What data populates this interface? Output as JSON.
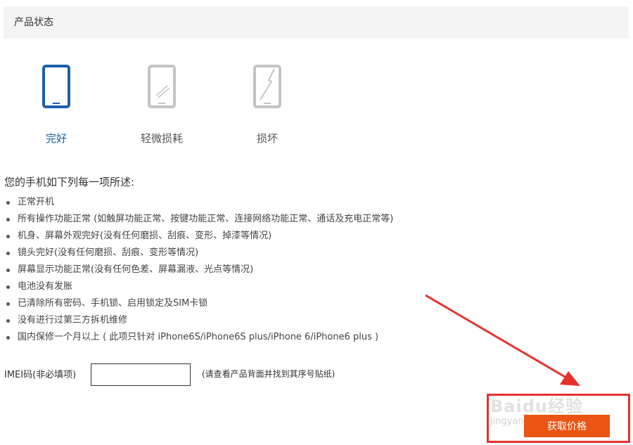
{
  "section": {
    "title": "产品状态"
  },
  "conditions": [
    {
      "label": "完好",
      "icon": "phone-intact-icon",
      "selected": true
    },
    {
      "label": "轻微损耗",
      "icon": "phone-scratched-icon",
      "selected": false
    },
    {
      "label": "损坏",
      "icon": "phone-cracked-icon",
      "selected": false
    }
  ],
  "description": {
    "title": "您的手机如下列每一项所述:",
    "items": [
      "正常开机",
      "所有操作功能正常 (如触屏功能正常、按键功能正常、连接网络功能正常、通话及充电正常等)",
      "机身、屏幕外观完好(没有任何磨损、刮痕、变形、掉漆等情况)",
      "镜头完好(没有任何磨损、刮痕、变形等情况)",
      "屏幕显示功能正常(没有任何色差、屏幕漏液、光点等情况)",
      "电池没有发胀",
      "已清除所有密码、手机锁、启用锁定及SIM卡锁",
      "没有进行过第三方拆机维修",
      "国内保修一个月以上 ( 此项只针对 iPhone6S/iPhone6S plus/iPhone 6/iPhone6 plus )"
    ]
  },
  "imei": {
    "label": "IMEI码(非必填项)",
    "value": "",
    "hint": "(请查看产品背面并找到其序号贴纸)"
  },
  "actions": {
    "get_quote_label": "获取价格"
  },
  "watermark": {
    "text": "Baidu经验",
    "url": "jingyan.baidu.com"
  },
  "colors": {
    "selected": "#1e5fa8",
    "inactive": "#c4c4c4",
    "accent": "#ea5514",
    "annotation": "#e5322d"
  }
}
